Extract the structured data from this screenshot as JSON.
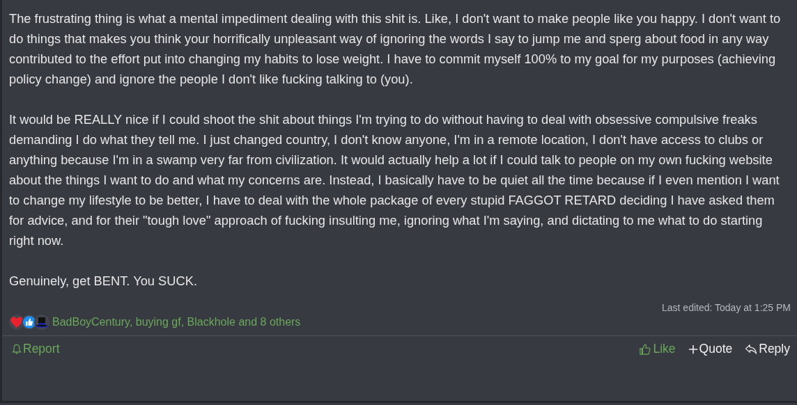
{
  "post": {
    "paragraphs": [
      "The frustrating thing is what a mental impediment dealing with this shit is. Like, I don't want to make people like you happy. I don't want to do things that makes you think your horrifically unpleasant way of ignoring the words I say to jump me and sperg about food in any way contributed to the effort put into changing my habits to lose weight. I have to commit myself 100% to my goal for my purposes (achieving policy change) and ignore the people I don't like fucking talking to (you).",
      "It would be REALLY nice if I could shoot the shit about things I'm trying to do without having to deal with obsessive compulsive freaks demanding I do what they tell me. I just changed country, I don't know anyone, I'm in a remote location, I don't have access to clubs or anything because I'm in a swamp very far from civilization. It would actually help a lot if I could talk to people on my own fucking website about the things I want to do and what my concerns are. Instead, I basically have to be quiet all the time because if I even mention I want to change my lifestyle to be better, I have to deal with the whole package of every stupid FAGGOT RETARD deciding I have asked them for advice, and for their \"tough love\" approach of fucking insulting me, ignoring what I'm saying, and dictating to me what to do starting right now.",
      "Genuinely, get BENT. You SUCK."
    ],
    "last_edited": "Last edited: Today at 1:25 PM",
    "reactions": {
      "icons": [
        {
          "kind": "heart"
        },
        {
          "kind": "thumb"
        },
        {
          "kind": "hat"
        }
      ],
      "text": "BadBoyCentury, buying gf, Blackhole and 8 others"
    },
    "actions_left": [
      {
        "kind": "report",
        "label": "Report"
      }
    ],
    "actions_right": [
      {
        "kind": "like",
        "label": "Like",
        "on": true
      },
      {
        "kind": "quote",
        "label": "Quote",
        "on": false
      },
      {
        "kind": "reply",
        "label": "Reply",
        "on": false
      }
    ]
  }
}
